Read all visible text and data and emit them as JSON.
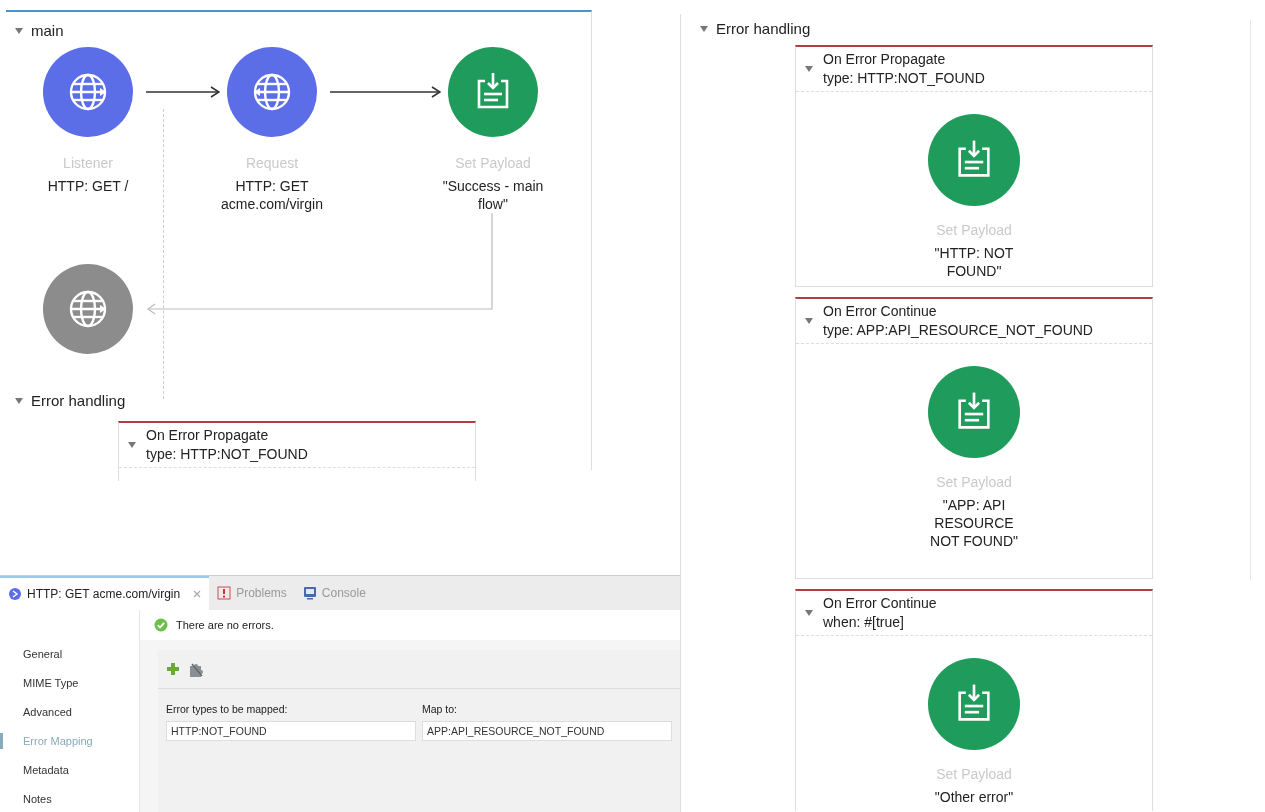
{
  "main_flow": {
    "title": "main",
    "expanded": true,
    "source": {
      "kind": "listener",
      "name": "Listener",
      "label": "HTTP: GET /"
    },
    "processors": [
      {
        "kind": "request",
        "name": "Request",
        "label": "HTTP: GET acme.com/virgin"
      },
      {
        "kind": "set-payload",
        "name": "Set Payload",
        "label": "\"Success - main flow\""
      }
    ],
    "error_handling": {
      "title": "Error handling",
      "expanded": true,
      "handlers": [
        {
          "title": "On Error Propagate",
          "condition": "type: HTTP:NOT_FOUND",
          "expanded": true
        }
      ]
    }
  },
  "error_handling_detail": {
    "title": "Error handling",
    "expanded": true,
    "handlers": [
      {
        "title": "On Error Propagate",
        "condition": "type: HTTP:NOT_FOUND",
        "expanded": true,
        "processor": {
          "kind": "set-payload",
          "name": "Set Payload",
          "label": "\"HTTP: NOT FOUND\""
        }
      },
      {
        "title": "On Error Continue",
        "condition": "type: APP:API_RESOURCE_NOT_FOUND",
        "expanded": true,
        "processor": {
          "kind": "set-payload",
          "name": "Set Payload",
          "label": "\"APP: API RESOURCE NOT FOUND\""
        }
      },
      {
        "title": "On Error Continue",
        "condition": "when: #[true]",
        "expanded": true,
        "processor": {
          "kind": "set-payload",
          "name": "Set Payload",
          "label": "\"Other error\""
        }
      }
    ]
  },
  "properties": {
    "tabs": [
      {
        "kind": "editor",
        "label": "HTTP: GET acme.com/virgin",
        "selected": true,
        "closable": true
      },
      {
        "kind": "problems",
        "label": "Problems",
        "selected": false,
        "closable": false
      },
      {
        "kind": "console",
        "label": "Console",
        "selected": false,
        "closable": false
      }
    ],
    "status": "There are no errors.",
    "sections": [
      {
        "label": "General",
        "selected": false
      },
      {
        "label": "MIME Type",
        "selected": false
      },
      {
        "label": "Advanced",
        "selected": false
      },
      {
        "label": "Error Mapping",
        "selected": true
      },
      {
        "label": "Metadata",
        "selected": false
      },
      {
        "label": "Notes",
        "selected": false
      }
    ],
    "mapping": {
      "columns": [
        "Error types to be mapped:",
        "Map to:"
      ],
      "rows": [
        [
          "HTTP:NOT_FOUND",
          "APP:API_RESOURCE_NOT_FOUND"
        ]
      ]
    }
  }
}
